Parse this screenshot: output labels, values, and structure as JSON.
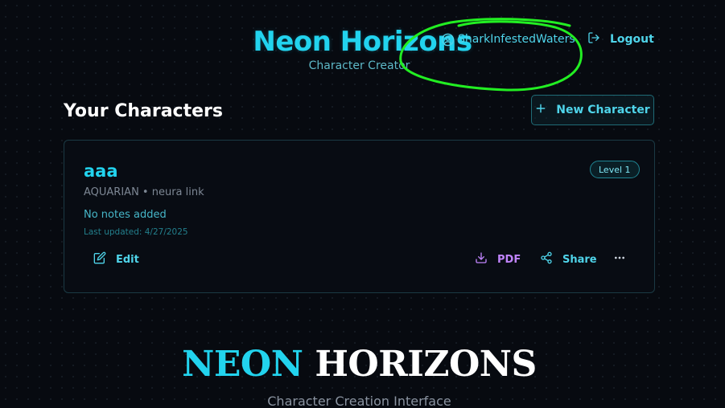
{
  "header": {
    "title": "Neon Horizons",
    "subtitle": "Character Creator",
    "username": "SharkInfestedWaters",
    "logout_label": "Logout"
  },
  "section": {
    "title": "Your Characters",
    "new_character_label": "New Character"
  },
  "characters": [
    {
      "name": "aaa",
      "level_badge": "Level 1",
      "meta": "AQUARIAN • neura link",
      "notes": "No notes added",
      "last_updated": "Last updated: 4/27/2025",
      "actions": {
        "edit": "Edit",
        "pdf": "PDF",
        "share": "Share"
      }
    }
  ],
  "footer": {
    "title_part1": "NEON",
    "title_part2": "HORIZONS",
    "subtitle": "Character Creation Interface"
  },
  "colors": {
    "accent": "#22d3ee",
    "pdf": "#c084fc",
    "background": "#070a10",
    "annotation": "#22ee22"
  },
  "icons": [
    "user-circle-icon",
    "logout-icon",
    "plus-icon",
    "edit-icon",
    "download-icon",
    "share-icon",
    "more-horizontal-icon"
  ]
}
